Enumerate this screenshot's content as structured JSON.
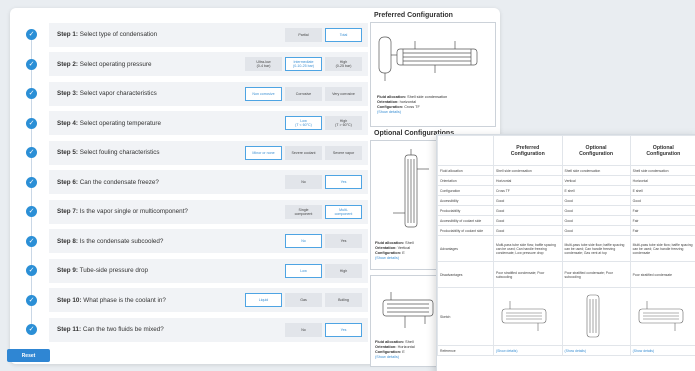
{
  "steps": [
    {
      "label": "Step 1:",
      "text": "Select type of condensation",
      "options": [
        {
          "label": "Partial",
          "selected": false
        },
        {
          "label": "Total",
          "selected": true
        }
      ]
    },
    {
      "label": "Step 2:",
      "text": "Select operating pressure",
      "options": [
        {
          "label": "Ultra-low\n(0-4 bar)",
          "selected": false
        },
        {
          "label": "Intermediate\n(0-10-25 bar)",
          "selected": true
        },
        {
          "label": "High\n(0-25 bar)",
          "selected": false
        }
      ]
    },
    {
      "label": "Step 3:",
      "text": "Select vapor characteristics",
      "options": [
        {
          "label": "Non corrosive",
          "selected": true
        },
        {
          "label": "Corrosive",
          "selected": false
        },
        {
          "label": "Very corrosive",
          "selected": false
        }
      ]
    },
    {
      "label": "Step 4:",
      "text": "Select operating temperature",
      "options": [
        {
          "label": "Low\n(T < 60°C)",
          "selected": true
        },
        {
          "label": "High\n(T > 60°C)",
          "selected": false
        }
      ]
    },
    {
      "label": "Step 5:",
      "text": "Select fouling characteristics",
      "options": [
        {
          "label": "Minor or none",
          "selected": true
        },
        {
          "label": "Severe coolant",
          "selected": false
        },
        {
          "label": "Severe vapor",
          "selected": false
        }
      ]
    },
    {
      "label": "Step 6:",
      "text": "Can the condensate freeze?",
      "options": [
        {
          "label": "No",
          "selected": false
        },
        {
          "label": "Yes",
          "selected": true
        }
      ]
    },
    {
      "label": "Step 7:",
      "text": "Is the vapor single or multicomponent?",
      "options": [
        {
          "label": "Single\ncomponent",
          "selected": false
        },
        {
          "label": "Multi-\ncomponent",
          "selected": true
        }
      ]
    },
    {
      "label": "Step 8:",
      "text": "Is the condensate subcooled?",
      "options": [
        {
          "label": "No",
          "selected": true
        },
        {
          "label": "Yes",
          "selected": false
        }
      ]
    },
    {
      "label": "Step 9:",
      "text": "Tube-side pressure drop",
      "options": [
        {
          "label": "Low",
          "selected": true
        },
        {
          "label": "High",
          "selected": false
        }
      ]
    },
    {
      "label": "Step 10:",
      "text": "What phase is the coolant in?",
      "options": [
        {
          "label": "Liquid",
          "selected": true
        },
        {
          "label": "Gas",
          "selected": false
        },
        {
          "label": "Boiling",
          "selected": false
        }
      ]
    },
    {
      "label": "Step 11:",
      "text": "Can the two fluids be mixed?",
      "options": [
        {
          "label": "No",
          "selected": false
        },
        {
          "label": "Yes",
          "selected": true
        }
      ]
    }
  ],
  "reset_label": "Reset",
  "preferred": {
    "title": "Preferred Configuration",
    "fluid": "Fluid allocation:",
    "fluid_val": "Shell side condensation",
    "orient": "Orientation:",
    "orient_val": "horizontal",
    "config": "Configuration:",
    "config_val": "Cross TF",
    "link": "(Show details)"
  },
  "optional": {
    "title": "Optional Configurations",
    "a_fluid": "Fluid allocation:",
    "a_fluid_val": "Shell",
    "a_orient": "Orientation:",
    "a_orient_val": "Vertical",
    "a_config": "Configuration:",
    "a_config_val": "E",
    "a_link": "(Show details)",
    "b_fluid": "Fluid allocation:",
    "b_fluid_val": "Shell",
    "b_orient": "Orientation:",
    "b_orient_val": "Horizontal",
    "b_config": "Configuration:",
    "b_config_val": "E",
    "b_link": "(Show details)"
  },
  "table": {
    "headers": [
      "",
      "Preferred\nConfiguration",
      "Optional\nConfiguration",
      "Optional\nConfiguration"
    ],
    "rows": [
      [
        "Fluid allocation",
        "Shell side condensation",
        "Shell side condensation",
        "Shell side condensation"
      ],
      [
        "Orientation",
        "Horizontal",
        "Vertical",
        "Horizontal"
      ],
      [
        "Configuration",
        "Cross TF",
        "E shell",
        "E shell"
      ],
      [
        "Accessibility",
        "Good",
        "Good",
        "Good"
      ],
      [
        "Productability",
        "Good",
        "Good",
        "Fair"
      ],
      [
        "Accessibility of coolant side",
        "Good",
        "Good",
        "Fair"
      ],
      [
        "Productability of coolant side",
        "Good",
        "Good",
        "Fair"
      ],
      [
        "Advantages",
        "Multi-pass tube side flow; baffle spacing can be used; Can handle freezing condensate; Low pressure drop",
        "Multi-pass tube side flow; baffle spacing can be used; Can handle freezing condensate; Gas vent at top",
        "Multi-pass tube side flow; baffle spacing can be used; Can handle freezing condensate"
      ],
      [
        "Disadvantages",
        "Poor stratified condensate; Poor subcooling",
        "Poor stratified condensate; Poor subcooling",
        "Poor stratified condensate"
      ],
      [
        "Sketch",
        "",
        "",
        ""
      ],
      [
        "Reference",
        "(Show details)",
        "(Show details)",
        "(Show details)"
      ]
    ]
  },
  "colors": {
    "accent": "#2b8fd6",
    "selected_border": "#4ea4e3",
    "step_bg": "#f1f3f6",
    "option_bg": "#e2e5ea"
  },
  "icons": {
    "step_status": "check-icon"
  }
}
